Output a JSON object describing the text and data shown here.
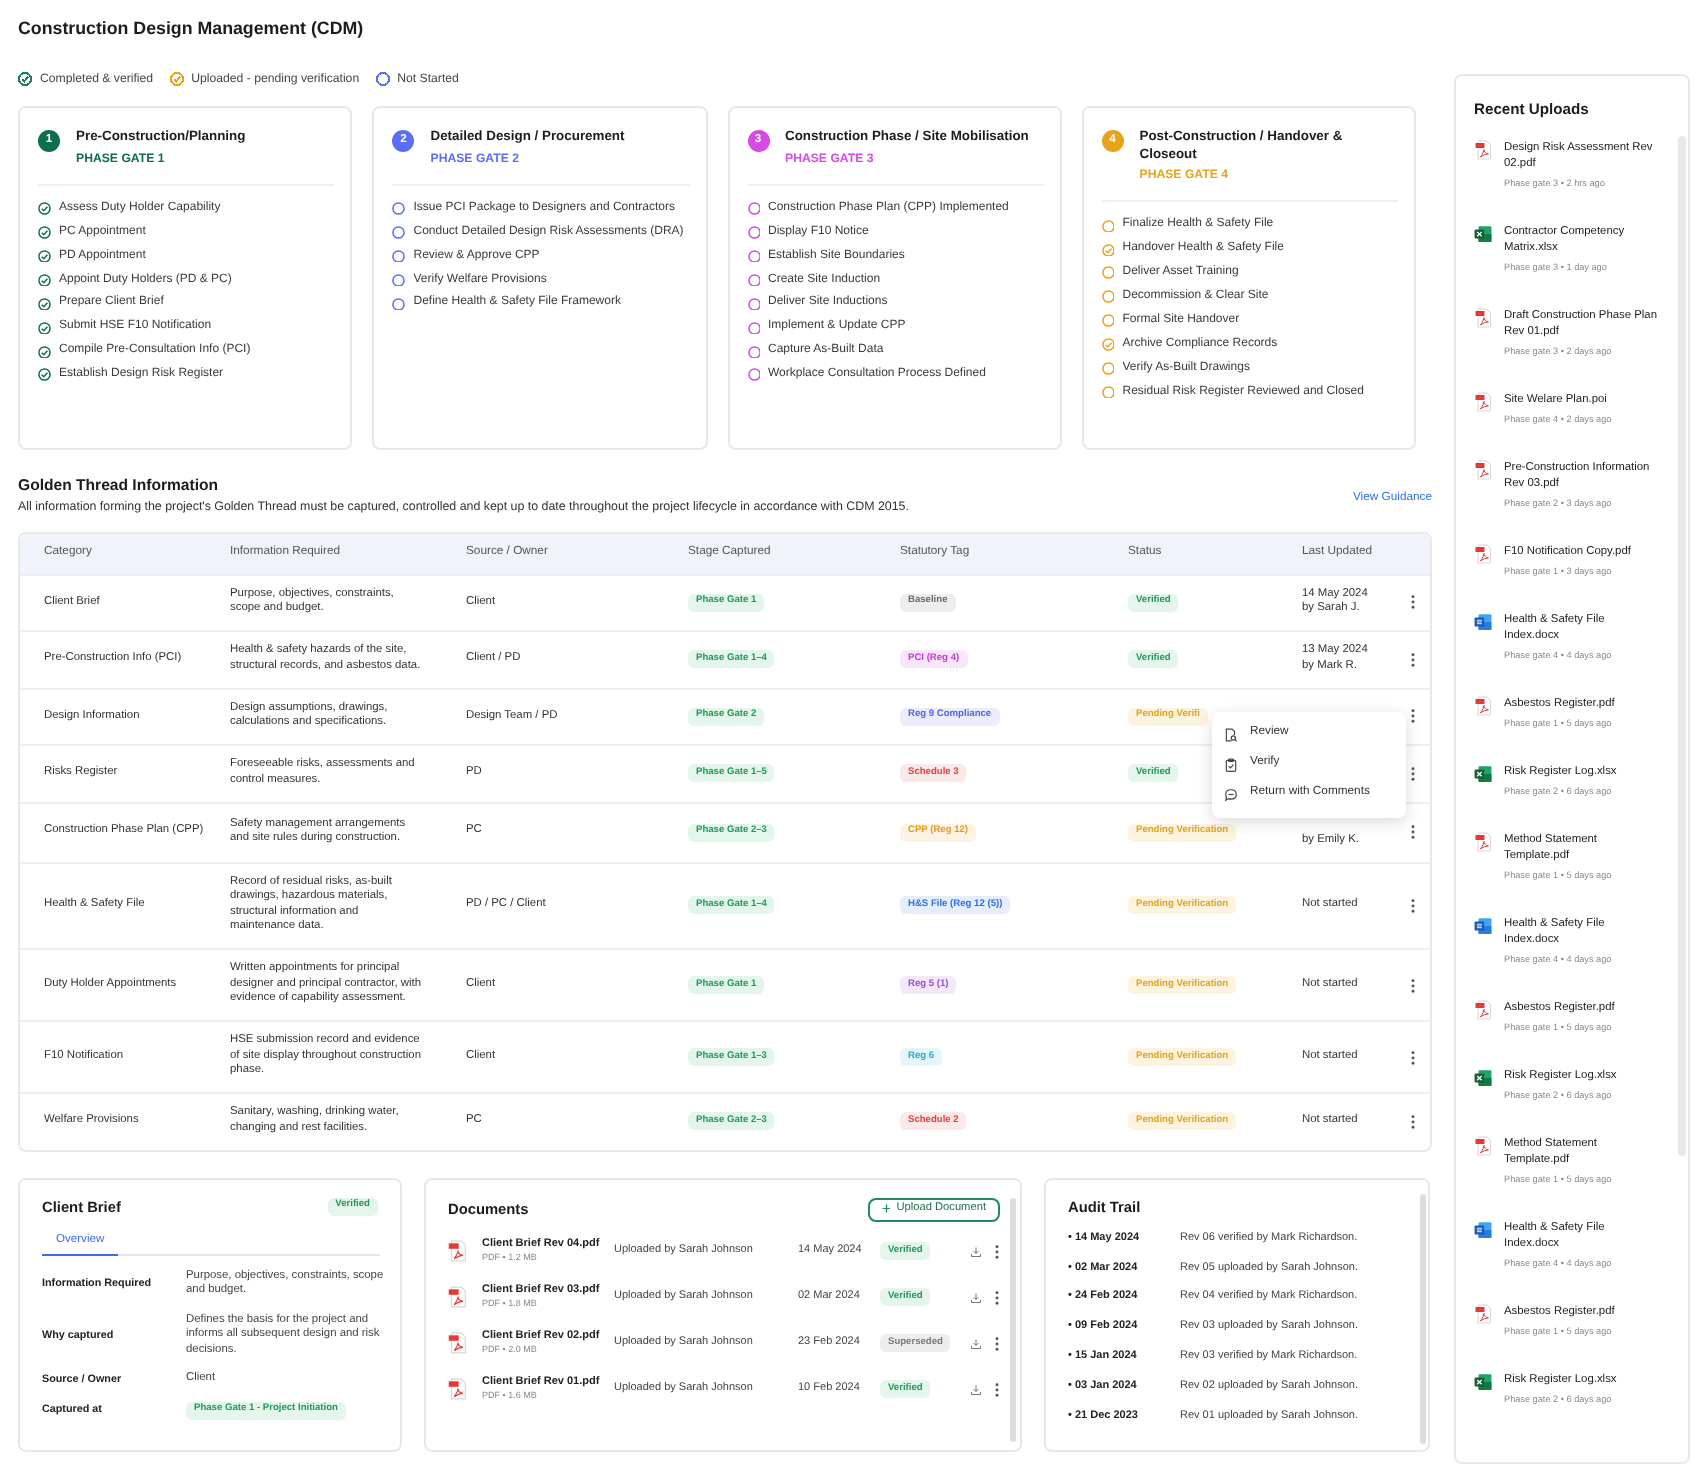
{
  "title": "Construction Design Management (CDM)",
  "legend": [
    {
      "checked": true,
      "label": "Completed & verified",
      "color": "#1a7f5a"
    },
    {
      "checked": true,
      "label": "Uploaded - pending verification",
      "color": "#e9a319"
    },
    {
      "checked": false,
      "label": "Not Started",
      "color": "#5b6ef5"
    }
  ],
  "phases": [
    {
      "number": "1",
      "title": "Pre-Construction/Planning",
      "gate": "PHASE GATE 1",
      "color": "#0f6e50",
      "items": [
        {
          "label": "Assess Duty Holder Capability",
          "checked": true
        },
        {
          "label": "PC Appointment",
          "checked": true
        },
        {
          "label": "PD Appointment",
          "checked": true
        },
        {
          "label": "Appoint Duty Holders (PD & PC)",
          "checked": true
        },
        {
          "label": "Prepare Client Brief",
          "checked": true
        },
        {
          "label": "Submit HSE F10 Notification",
          "checked": true
        },
        {
          "label": "Compile Pre-Consultation Info (PCI)",
          "checked": true
        },
        {
          "label": "Establish Design Risk Register",
          "checked": true
        }
      ]
    },
    {
      "number": "2",
      "title": "Detailed Design / Procurement",
      "gate": "PHASE GATE 2",
      "color": "#5b6ef5",
      "items": [
        {
          "label": "Issue PCI Package to Designers and Contractors",
          "checked": false
        },
        {
          "label": "Conduct Detailed Design Risk Assessments (DRA)",
          "checked": false
        },
        {
          "label": "Review & Approve CPP",
          "checked": false
        },
        {
          "label": "Verify Welfare Provisions",
          "checked": false
        },
        {
          "label": "Define Health & Safety File Framework",
          "checked": false
        }
      ]
    },
    {
      "number": "3",
      "title": "Construction Phase / Site Mobilisation",
      "gate": "PHASE GATE 3",
      "color": "#d64ae6",
      "items": [
        {
          "label": "Construction Phase Plan (CPP) Implemented",
          "checked": false
        },
        {
          "label": "Display F10 Notice",
          "checked": false
        },
        {
          "label": "Establish Site Boundaries",
          "checked": false
        },
        {
          "label": "Create Site Induction",
          "checked": false
        },
        {
          "label": "Deliver Site Inductions",
          "checked": false
        },
        {
          "label": "Implement & Update CPP",
          "checked": false
        },
        {
          "label": "Capture As-Built Data",
          "checked": false
        },
        {
          "label": "Workplace Consultation Process Defined",
          "checked": false
        }
      ]
    },
    {
      "number": "4",
      "title": "Post-Construction / Handover & Closeout",
      "gate": "PHASE GATE 4",
      "color": "#e9a319",
      "items": [
        {
          "label": "Finalize Health & Safety File",
          "checked": false
        },
        {
          "label": "Handover Health & Safety File",
          "checked": true
        },
        {
          "label": "Deliver Asset Training",
          "checked": false
        },
        {
          "label": "Decommission & Clear Site",
          "checked": false
        },
        {
          "label": "Formal Site Handover",
          "checked": false
        },
        {
          "label": "Archive Compliance Records",
          "checked": true
        },
        {
          "label": "Verify As-Built Drawings",
          "checked": false
        },
        {
          "label": "Residual Risk Register Reviewed and Closed",
          "checked": false
        }
      ]
    }
  ],
  "golden_thread": {
    "title": "Golden Thread Information",
    "description": "All information forming the project's Golden Thread must be captured, controlled and kept up to date throughout the project lifecycle in accordance with CDM 2015.",
    "link": "View Guidance",
    "table": {
      "columns": [
        "Category",
        "Information Required",
        "Source / Owner",
        "Stage Captured",
        "Statutory Tag",
        "Status",
        "Last Updated"
      ],
      "rows": [
        {
          "category": "Client Brief",
          "info": "Purpose, objectives, constraints, scope and budget.",
          "source": "Client",
          "stage": "Phase Gate 1",
          "tag": {
            "label": "Baseline",
            "color": "#6b6b6b"
          },
          "status": {
            "label": "Verified",
            "kind": "verified"
          },
          "updated": {
            "date": "14 May 2024",
            "by": "by Sarah J."
          }
        },
        {
          "category": "Pre-Construction Info (PCI)",
          "info": "Health & safety hazards of the site, structural records, and asbestos data.",
          "source": "Client / PD",
          "stage": "Phase Gate 1–4",
          "tag": {
            "label": "PCI (Reg 4)",
            "color": "#c43ad8"
          },
          "status": {
            "label": "Verified",
            "kind": "verified"
          },
          "updated": {
            "date": "13 May 2024",
            "by": "by Mark R."
          }
        },
        {
          "category": "Design Information",
          "info": "Design assumptions, drawings, calculations and specifications.",
          "source": "Design Team / PD",
          "stage": "Phase Gate 2",
          "tag": {
            "label": "Reg 9 Compliance",
            "color": "#5561e8"
          },
          "status": {
            "label": "Pending Verifi",
            "kind": "pending"
          }
        },
        {
          "category": "Risks Register",
          "info": "Foreseeable risks, assessments and control measures.",
          "source": "PD",
          "stage": "Phase Gate 1–5",
          "tag": {
            "label": "Schedule 3",
            "color": "#e0413f"
          },
          "status": {
            "label": "Verified",
            "kind": "verified"
          }
        },
        {
          "category": "Construction Phase Plan (CPP)",
          "info": "Safety management arrangements and site rules during construction.",
          "source": "PC",
          "stage": "Phase Gate 2–3",
          "tag": {
            "label": "CPP (Reg 12)",
            "color": "#e49b1a"
          },
          "status": {
            "label": "Pending Verification",
            "kind": "pending"
          },
          "updated": {
            "by": "by Emily K."
          }
        },
        {
          "category": "Health & Safety File",
          "info": "Record of residual risks, as-built drawings, hazardous materials, structural information and maintenance data.",
          "source": "PD / PC / Client",
          "stage": "Phase Gate 1–4",
          "tag": {
            "label": "H&S File (Reg 12 (5))",
            "color": "#2f6ee8"
          },
          "status": {
            "label": "Pending Verification",
            "kind": "pending"
          },
          "updated": {
            "date": "Not started"
          }
        },
        {
          "category": "Duty Holder Appointments",
          "info": "Written appointments for principal designer and principal contractor, with evidence of capability assessment.",
          "source": "Client",
          "stage": "Phase Gate 1",
          "tag": {
            "label": "Reg 5 (1)",
            "color": "#9b4be0"
          },
          "status": {
            "label": "Pending Verification",
            "kind": "pending"
          },
          "updated": {
            "date": "Not started"
          }
        },
        {
          "category": "F10 Notification",
          "info": "HSE submission record and evidence of site display throughout construction phase.",
          "source": "Client",
          "stage": "Phase Gate 1–3",
          "tag": {
            "label": "Reg 6",
            "color": "#27a9d6"
          },
          "status": {
            "label": "Pending Verification",
            "kind": "pending"
          },
          "updated": {
            "date": "Not started"
          }
        },
        {
          "category": "Welfare Provisions",
          "info": "Sanitary, washing, drinking water, changing and rest facilities.",
          "source": "PC",
          "stage": "Phase Gate 2–3",
          "tag": {
            "label": "Schedule 2",
            "color": "#e0413f"
          },
          "status": {
            "label": "Pending Verification",
            "kind": "pending"
          },
          "updated": {
            "date": "Not started"
          }
        }
      ],
      "context_menu": {
        "items": [
          {
            "label": "Review",
            "kind": "review"
          },
          {
            "label": "Verify",
            "kind": "verify"
          },
          {
            "label": "Return with Comments",
            "kind": "comment"
          }
        ]
      }
    }
  },
  "client_brief": {
    "title": "Client Brief",
    "status": {
      "label": "Verified",
      "kind": "verified"
    },
    "tabs": [
      {
        "label": "Overview",
        "selected": true
      }
    ],
    "fields": [
      {
        "label": "Information Required",
        "value": "Purpose, objectives, constraints, scope and budget.",
        "kind": "text"
      },
      {
        "label": "Why captured",
        "value": "Defines the basis for the project and informs all subsequent design and risk decisions.",
        "kind": "text"
      },
      {
        "label": "Source / Owner",
        "value": "Client",
        "kind": "text"
      },
      {
        "label": "Captured at",
        "value": "Phase Gate 1 - Project Initiation",
        "kind": "pill"
      }
    ]
  },
  "documents": {
    "title": "Documents",
    "upload_button": "Upload Document",
    "files": [
      {
        "name": "Client Brief Rev 04.pdf",
        "meta": "PDF • 1.2 MB",
        "uploaded_by": "Uploaded by Sarah Johnson",
        "date": "14 May 2024",
        "status": {
          "label": "Verified",
          "kind": "verified"
        }
      },
      {
        "name": "Client Brief Rev 03.pdf",
        "meta": "PDF • 1.8 MB",
        "uploaded_by": "Uploaded by Sarah Johnson",
        "date": "02 Mar 2024",
        "status": {
          "label": "Verified",
          "kind": "verified"
        }
      },
      {
        "name": "Client Brief Rev 02.pdf",
        "meta": "PDF • 2.0 MB",
        "uploaded_by": "Uploaded by Sarah Johnson",
        "date": "23 Feb 2024",
        "status": {
          "label": "Superseded",
          "kind": "superseded"
        }
      },
      {
        "name": "Client Brief Rev 01.pdf",
        "meta": "PDF • 1.6 MB",
        "uploaded_by": "Uploaded by Sarah Johnson",
        "date": "10 Feb 2024",
        "status": {
          "label": "Verified",
          "kind": "verified"
        }
      }
    ]
  },
  "audit_trail": {
    "title": "Audit Trail",
    "entries": [
      {
        "date": "• 14 May 2024",
        "text": "Rev 06 verified by Mark Richardson."
      },
      {
        "date": "• 02 Mar 2024",
        "text": "Rev 05 uploaded by Sarah Johnson."
      },
      {
        "date": "• 24 Feb 2024",
        "text": "Rev 04 verified by Mark Richardson."
      },
      {
        "date": "• 09 Feb 2024",
        "text": "Rev 03 uploaded by Sarah Johnson."
      },
      {
        "date": "• 15 Jan 2024",
        "text": "Rev 03 verified by Mark Richardson."
      },
      {
        "date": "• 03 Jan 2024",
        "text": "Rev 02 uploaded by Sarah Johnson."
      },
      {
        "date": "• 21 Dec 2023",
        "text": "Rev 01 uploaded by Sarah Johnson."
      }
    ]
  },
  "recent_uploads": {
    "title": "Recent Uploads",
    "items": [
      {
        "name": "Design Risk Assessment Rev 02.pdf",
        "meta": "Phase gate 3 • 2 hrs ago",
        "kind": "pdf"
      },
      {
        "name": "Contractor Competency Matrix.xlsx",
        "meta": "Phase gate 3 • 1 day ago",
        "kind": "xlsx"
      },
      {
        "name": "Draft Construction Phase Plan Rev 01.pdf",
        "meta": "Phase gate 3 • 2 days ago",
        "kind": "pdf"
      },
      {
        "name": "Site Welare Plan.poi",
        "meta": "Phase gate 4 • 2 days ago",
        "kind": "pdf"
      },
      {
        "name": "Pre-Construction Information Rev 03.pdf",
        "meta": "Phase gate 2 • 3 days ago",
        "kind": "pdf"
      },
      {
        "name": "F10 Notification Copy.pdf",
        "meta": "Phase gate 1 • 3 days ago",
        "kind": "pdf"
      },
      {
        "name": "Health & Safety File Index.docx",
        "meta": "Phase gate 4 • 4 days ago",
        "kind": "docx"
      },
      {
        "name": "Asbestos Register.pdf",
        "meta": "Phase gate 1 • 5 days ago",
        "kind": "pdf"
      },
      {
        "name": "Risk Register Log.xlsx",
        "meta": "Phase gate 2 • 6 days ago",
        "kind": "xlsx"
      },
      {
        "name": "Method Statement Template.pdf",
        "meta": "Phase gate 1 • 5 days ago",
        "kind": "pdf"
      },
      {
        "name": "Health & Safety File Index.docx",
        "meta": "Phase gate 4 • 4 days ago",
        "kind": "docx"
      },
      {
        "name": "Asbestos Register.pdf",
        "meta": "Phase gate 1 • 5 days ago",
        "kind": "pdf"
      },
      {
        "name": "Risk Register Log.xlsx",
        "meta": "Phase gate 2 • 6 days ago",
        "kind": "xlsx"
      },
      {
        "name": "Method Statement Template.pdf",
        "meta": "Phase gate 1 • 5 days ago",
        "kind": "pdf"
      },
      {
        "name": "Health & Safety File Index.docx",
        "meta": "Phase gate 4 • 4 days ago",
        "kind": "docx"
      },
      {
        "name": "Asbestos Register.pdf",
        "meta": "Phase gate 1 • 5 days ago",
        "kind": "pdf"
      },
      {
        "name": "Risk Register Log.xlsx",
        "meta": "Phase gate 2 • 6 days ago",
        "kind": "xlsx"
      }
    ]
  }
}
